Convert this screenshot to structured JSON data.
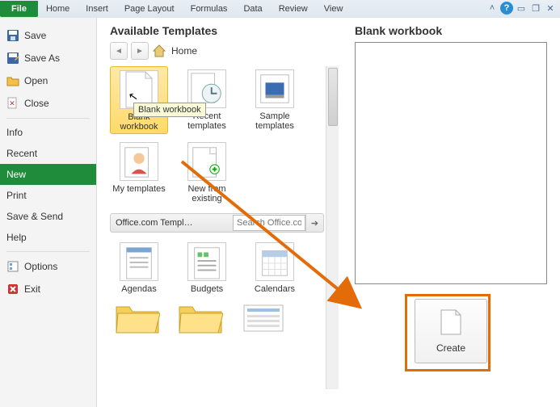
{
  "ribbon": {
    "file": "File",
    "tabs": [
      "Home",
      "Insert",
      "Page Layout",
      "Formulas",
      "Data",
      "Review",
      "View"
    ]
  },
  "sidebar": {
    "save": "Save",
    "save_as": "Save As",
    "open": "Open",
    "close": "Close",
    "info": "Info",
    "recent": "Recent",
    "new": "New",
    "print": "Print",
    "save_send": "Save & Send",
    "help": "Help",
    "options": "Options",
    "exit": "Exit"
  },
  "center": {
    "heading": "Available Templates",
    "breadcrumb": "Home",
    "tooltip": "Blank workbook",
    "templates": {
      "blank": "Blank workbook",
      "recent": "Recent templates",
      "sample": "Sample templates",
      "mytemplates": "My templates",
      "newfrom": "New from existing"
    },
    "office_label": "Office.com Templ…",
    "search_placeholder": "Search Office.co",
    "office_cats": {
      "agendas": "Agendas",
      "budgets": "Budgets",
      "calendars": "Calendars"
    }
  },
  "right": {
    "heading": "Blank workbook",
    "create": "Create"
  }
}
